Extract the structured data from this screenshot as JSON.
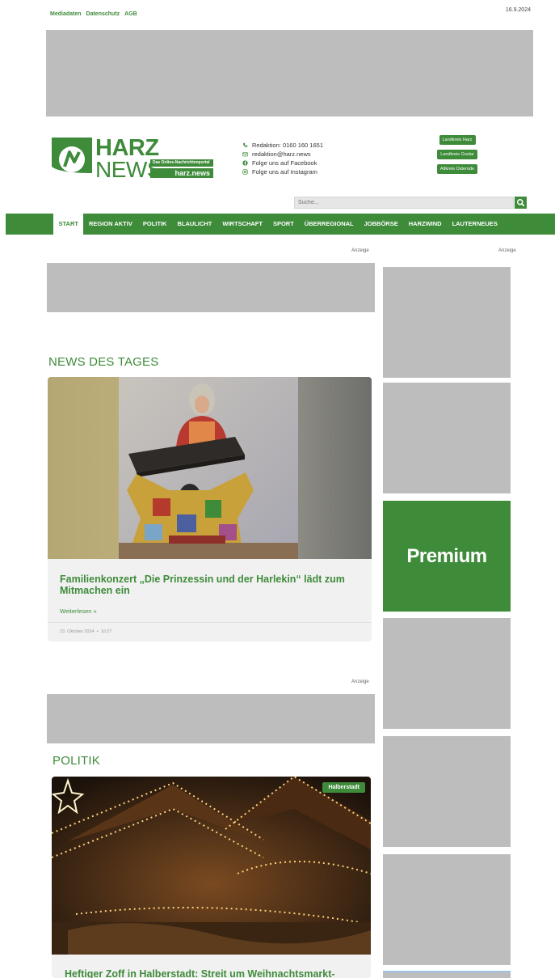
{
  "top_links": [
    "Mediadaten",
    "Datenschutz",
    "AGB"
  ],
  "date": "16.9.2024",
  "logo": {
    "harz": "HARZ",
    "news": "NEWS",
    "tagline": "Das Online-Nachrichtenportal",
    "url": "harz.news"
  },
  "contacts": [
    {
      "icon": "phone-icon",
      "text": "Redaktion: 0160 160 1651"
    },
    {
      "icon": "mail-icon",
      "text": "redaktion@harz.news"
    },
    {
      "icon": "facebook-icon",
      "text": "Folge uns auf Facebook"
    },
    {
      "icon": "instagram-icon",
      "text": "Folge uns auf Instagram"
    }
  ],
  "region_buttons": [
    "Landkreis Harz",
    "Landkreis Goslar",
    "Altkreis Osterode"
  ],
  "search": {
    "placeholder": "Suche..."
  },
  "nav": [
    "START",
    "REGION AKTIV",
    "POLITIK",
    "BLAULICHT",
    "WIRTSCHAFT",
    "SPORT",
    "ÜBERREGIONAL",
    "JOBBÖRSE",
    "HARZWIND",
    "LAUTERNEUES"
  ],
  "anzeige_label": "Anzeige",
  "news_des_tages": {
    "title": "NEWS DES TAGES",
    "article_title": "Familienkonzert „Die Prinzessin und der Harlekin“ lädt zum Mitmachen ein",
    "read_more": "Weiterlesen »",
    "meta_date": "23. Oktober 2024",
    "meta_sep": "•",
    "meta_time": "10:27"
  },
  "politik": {
    "title": "POLITIK",
    "badge": "Halberstadt",
    "article_title": "Heftiger Zoff in Halberstadt: Streit um Weihnachtsmarkt-"
  },
  "sidebar": {
    "premium_label": "Premium"
  },
  "colors": {
    "brand_green": "#3e8b3a",
    "ad_gray": "#bdbdbd",
    "card_bg": "#f1f1f1"
  }
}
